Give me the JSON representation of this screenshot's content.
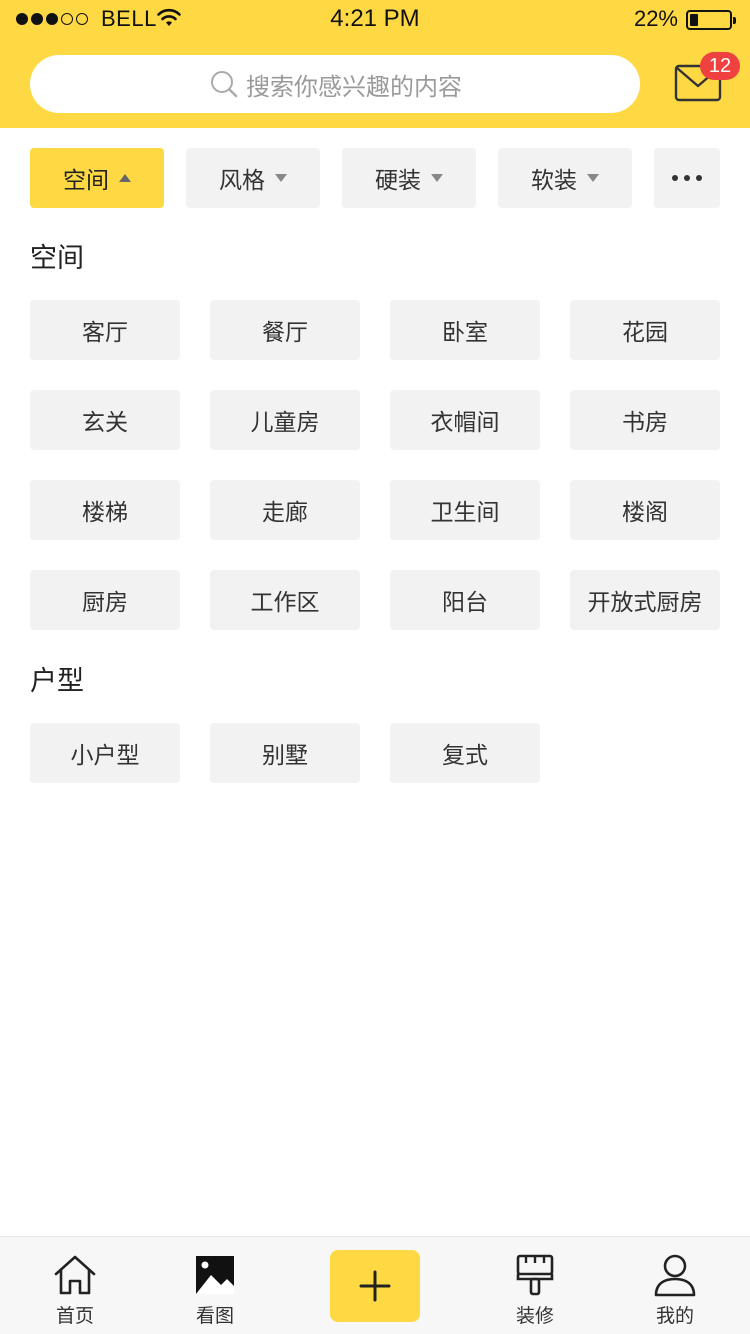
{
  "status_bar": {
    "carrier": "BELL",
    "time": "4:21 PM",
    "battery_pct": "22%",
    "battery_level": 0.22,
    "signal_dots_filled": 3,
    "signal_dots_total": 5
  },
  "search": {
    "placeholder": "搜索你感兴趣的内容",
    "icon": "search-icon"
  },
  "mail": {
    "icon": "mail-icon",
    "badge": "12"
  },
  "filters": [
    {
      "label": "空间",
      "active": true
    },
    {
      "label": "风格",
      "active": false
    },
    {
      "label": "硬装",
      "active": false
    },
    {
      "label": "软装",
      "active": false
    }
  ],
  "filter_more_icon": "more-icon",
  "sections": [
    {
      "title": "空间",
      "items": [
        "客厅",
        "餐厅",
        "卧室",
        "花园",
        "玄关",
        "儿童房",
        "衣帽间",
        "书房",
        "楼梯",
        "走廊",
        "卫生间",
        "楼阁",
        "厨房",
        "工作区",
        "阳台",
        "开放式厨房"
      ]
    },
    {
      "title": "户型",
      "items": [
        "小户型",
        "别墅",
        "复式"
      ]
    }
  ],
  "tabbar": [
    {
      "label": "首页",
      "icon": "home-icon"
    },
    {
      "label": "看图",
      "icon": "image-icon"
    },
    {
      "label": "",
      "icon": "plus-icon"
    },
    {
      "label": "装修",
      "icon": "paint-brush-icon"
    },
    {
      "label": "我的",
      "icon": "user-icon"
    }
  ],
  "colors": {
    "accent": "#FFD944",
    "chip_bg": "#F2F2F2",
    "badge": "#F04141"
  }
}
